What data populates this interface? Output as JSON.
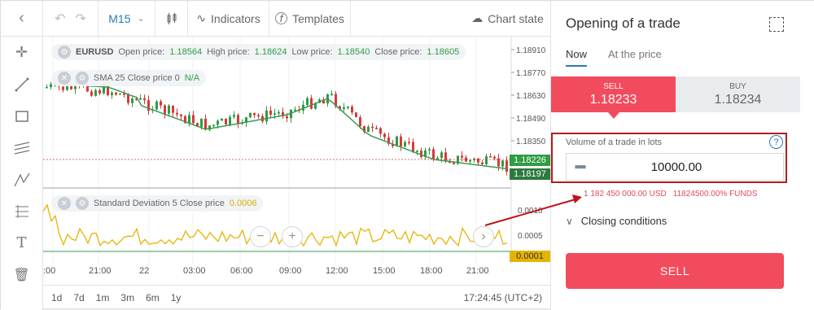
{
  "toolbar": {
    "timeframe": "M15",
    "indicators_label": "Indicators",
    "templates_label": "Templates",
    "chart_state_label": "Chart state"
  },
  "chart": {
    "ohlc": {
      "symbol": "EURUSD",
      "open_label": "Open price:",
      "open": "1.18564",
      "high_label": "High price:",
      "high": "1.18624",
      "low_label": "Low price:",
      "low": "1.18540",
      "close_label": "Close price:",
      "close": "1.18605"
    },
    "sma": {
      "label": "SMA 25 Close price 0",
      "value": "N/A"
    },
    "stddev": {
      "label": "Standard Deviation 5 Close price",
      "value": "0.0006"
    },
    "price_ticks": [
      "1.18910",
      "1.18770",
      "1.18630",
      "1.18490",
      "1.18350"
    ],
    "price_tag_green": "1.18226",
    "price_tag_dark": "1.18197",
    "sub_ticks": [
      "0.0010",
      "0.0005"
    ],
    "sub_tag": "0.0001",
    "time_ticks": [
      ":00",
      "21:00",
      "22",
      "03:00",
      "06:00",
      "09:00",
      "12:00",
      "15:00",
      "18:00",
      "21:00"
    ],
    "colors": {
      "up": "#2e9c44",
      "down": "#d63a3a",
      "sma": "#3a9a54",
      "stddev": "#e5b400"
    }
  },
  "bottombar": {
    "ranges": [
      "1d",
      "7d",
      "1m",
      "3m",
      "6m",
      "1y"
    ],
    "clock": "17:24:45 (UTC+2)"
  },
  "panel": {
    "title": "Opening of a trade",
    "tabs": [
      "Now",
      "At the price"
    ],
    "sell_label": "SELL",
    "sell_price": "1.18233",
    "buy_label": "BUY",
    "buy_price": "1.18234",
    "volume_label": "Volume of a trade in lots",
    "volume_value": "10000.00",
    "funds_amount": "1 182 450 000.00 USD",
    "funds_percent": "11824500.00% FUNDS",
    "closing_label": "Closing conditions",
    "sell_button": "SELL",
    "accent": "#f24b5e"
  }
}
